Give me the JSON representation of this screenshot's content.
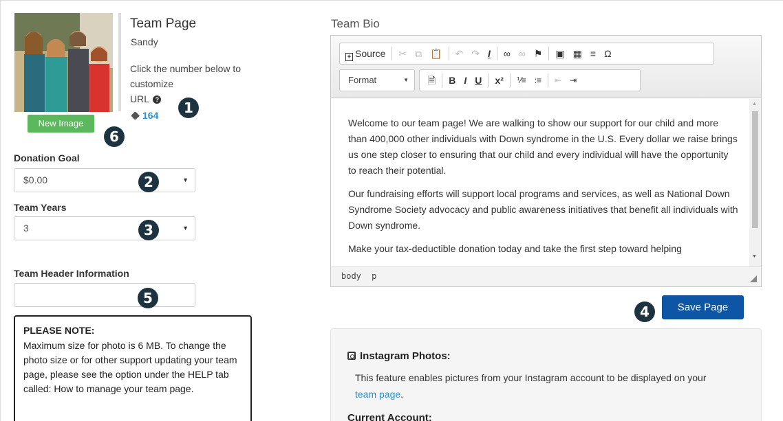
{
  "profile": {
    "title": "Team Page",
    "subtitle": "Sandy",
    "customize_text": "Click the number below to customize",
    "url_label": "URL",
    "help_icon": "?",
    "url_number": "164",
    "new_image_label": "New Image"
  },
  "badges": [
    "1",
    "2",
    "3",
    "4",
    "5",
    "6"
  ],
  "form": {
    "donation_goal_label": "Donation Goal",
    "donation_goal_value": "$0.00",
    "team_years_label": "Team Years",
    "team_years_value": "3",
    "header_info_label": "Team Header Information",
    "header_info_value": ""
  },
  "note": {
    "title": "PLEASE NOTE:",
    "body": "Maximum size for photo is 6 MB. To change the photo size or for other support updating your team page, please see the option under the HELP tab called: How to manage your team page."
  },
  "bio": {
    "label": "Team Bio",
    "toolbar": {
      "source": "Source",
      "format": "Format"
    },
    "paragraphs": [
      "Welcome to our team page!  We are walking to show our support for our child and more than 400,000 other individuals with Down syndrome in the U.S. Every dollar we raise brings us one step closer to ensuring that our child and every individual will have the opportunity to reach their potential.",
      "Our fundraising efforts will support local programs and services, as well as National Down Syndrome Society advocacy and public awareness initiatives that benefit all individuals with Down syndrome.",
      "Make your tax-deductible donation today and take the first step toward helping"
    ],
    "status_path": [
      "body",
      "p"
    ]
  },
  "save_label": "Save Page",
  "instagram": {
    "title": "Instagram Photos:",
    "desc_before": "This feature enables pictures from your Instagram account to be displayed on your ",
    "desc_link": "team page",
    "desc_after": ".",
    "current_account": "Current Account:"
  },
  "colors": {
    "badge": "#1e3340",
    "save_button": "#0d56a6",
    "new_image_button": "#5cb85c",
    "link": "#2a8fd0"
  }
}
